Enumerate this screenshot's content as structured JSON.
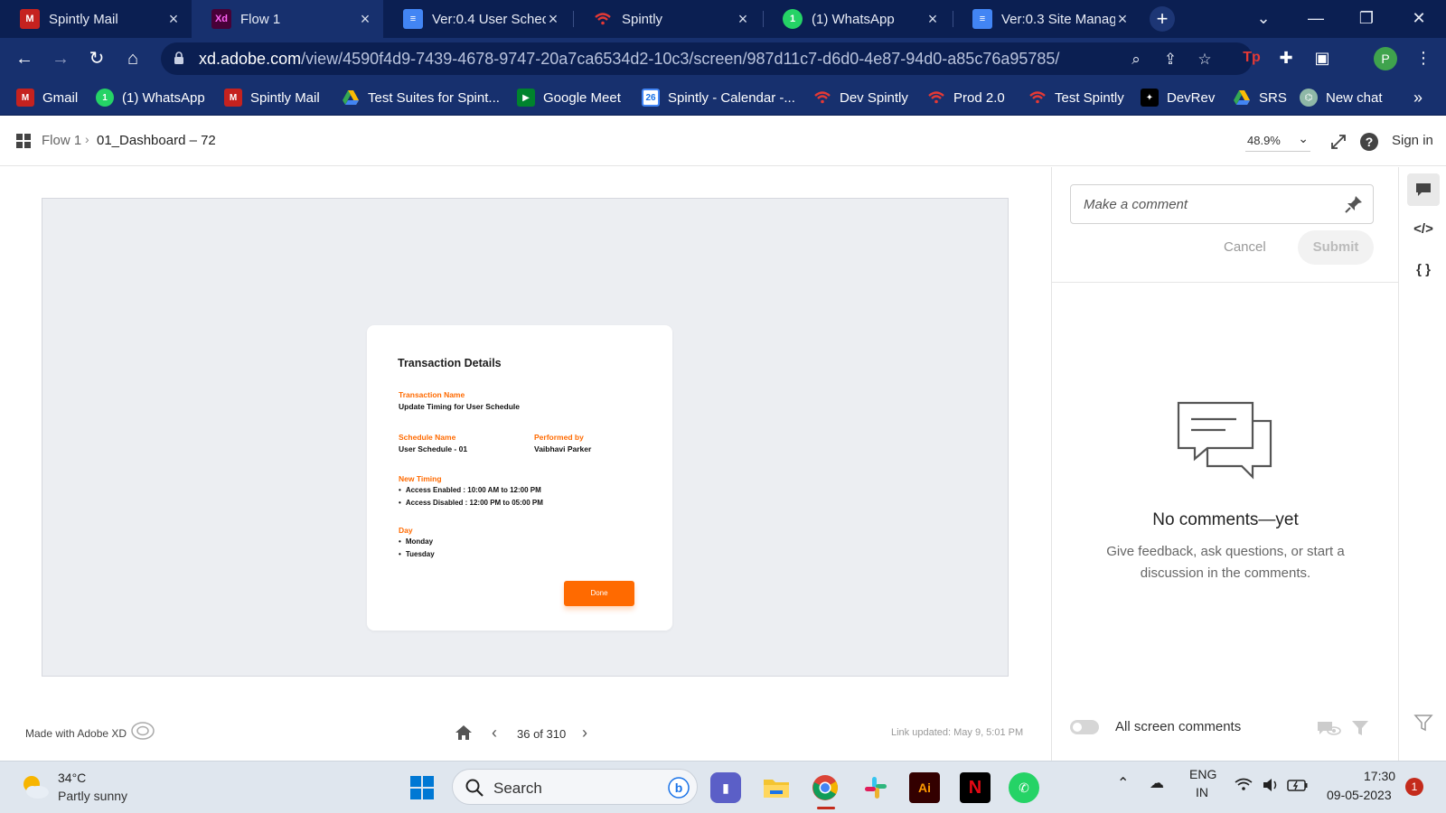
{
  "browser": {
    "tabs": [
      {
        "title": "Spintly Mail",
        "icon": "gmail-icon"
      },
      {
        "title": "Flow 1",
        "icon": "adobe-xd-icon"
      },
      {
        "title": "Ver:0.4 User Schedu",
        "icon": "google-docs-icon"
      },
      {
        "title": "Spintly",
        "icon": "wifi-icon"
      },
      {
        "title": "(1) WhatsApp",
        "icon": "whatsapp-icon"
      },
      {
        "title": "Ver:0.3 Site Manag",
        "icon": "google-docs-icon"
      }
    ],
    "active_tab_index": 1,
    "url_host": "xd.adobe.com",
    "url_path": "/view/4590f4d9-7439-4678-9747-20a7ca6534d2-10c3/screen/987d11c7-d6d0-4e87-94d0-a85c76a95785/",
    "profile_initial": "P",
    "bookmarks": [
      {
        "label": "Gmail",
        "icon": "gmail-icon"
      },
      {
        "label": "(1) WhatsApp",
        "icon": "whatsapp-icon"
      },
      {
        "label": "Spintly Mail",
        "icon": "gmail-icon"
      },
      {
        "label": "Test Suites for Spint...",
        "icon": "google-drive-icon"
      },
      {
        "label": "Google Meet",
        "icon": "google-meet-icon"
      },
      {
        "label": "Spintly - Calendar -...",
        "icon": "google-calendar-icon"
      },
      {
        "label": "Dev Spintly",
        "icon": "wifi-icon"
      },
      {
        "label": "Prod 2.0",
        "icon": "wifi-icon"
      },
      {
        "label": "Test Spintly",
        "icon": "wifi-icon"
      },
      {
        "label": "DevRev",
        "icon": "devrev-icon"
      },
      {
        "label": "SRS",
        "icon": "google-drive-icon"
      },
      {
        "label": "New chat",
        "icon": "chatgpt-icon"
      }
    ],
    "calendar_day": "26"
  },
  "xd": {
    "breadcrumb_flow": "Flow 1",
    "breadcrumb_screen": "01_Dashboard – 72",
    "zoom": "48.9%",
    "sign_in": "Sign in",
    "made_with": "Made with Adobe XD",
    "page_indicator": "36 of 310",
    "link_updated": "Link updated: May 9, 5:01 PM"
  },
  "card": {
    "title": "Transaction Details",
    "transaction_name_label": "Transaction Name",
    "transaction_name_value": "Update Timing for User Schedule",
    "schedule_name_label": "Schedule Name",
    "schedule_name_value": "User Schedule - 01",
    "performed_by_label": "Performed by",
    "performed_by_value": "Vaibhavi Parker",
    "new_timing_label": "New Timing",
    "new_timing_items": [
      "Access Enabled : 10:00 AM to 12:00 PM",
      "Access Disabled : 12:00 PM to 05:00 PM"
    ],
    "day_label": "Day",
    "day_items": [
      "Monday",
      "Tuesday"
    ],
    "done_label": "Done",
    "accent_color": "#ff6a00"
  },
  "comments": {
    "placeholder": "Make a comment",
    "cancel_label": "Cancel",
    "submit_label": "Submit",
    "empty_title": "No comments—yet",
    "empty_subtitle": "Give feedback, ask questions, or start a discussion in the comments.",
    "all_screen_label": "All screen comments"
  },
  "taskbar": {
    "temperature": "34°C",
    "weather": "Partly sunny",
    "search_label": "Search",
    "language_1": "ENG",
    "language_2": "IN",
    "time": "17:30",
    "date": "09-05-2023",
    "notification_count": "1"
  }
}
